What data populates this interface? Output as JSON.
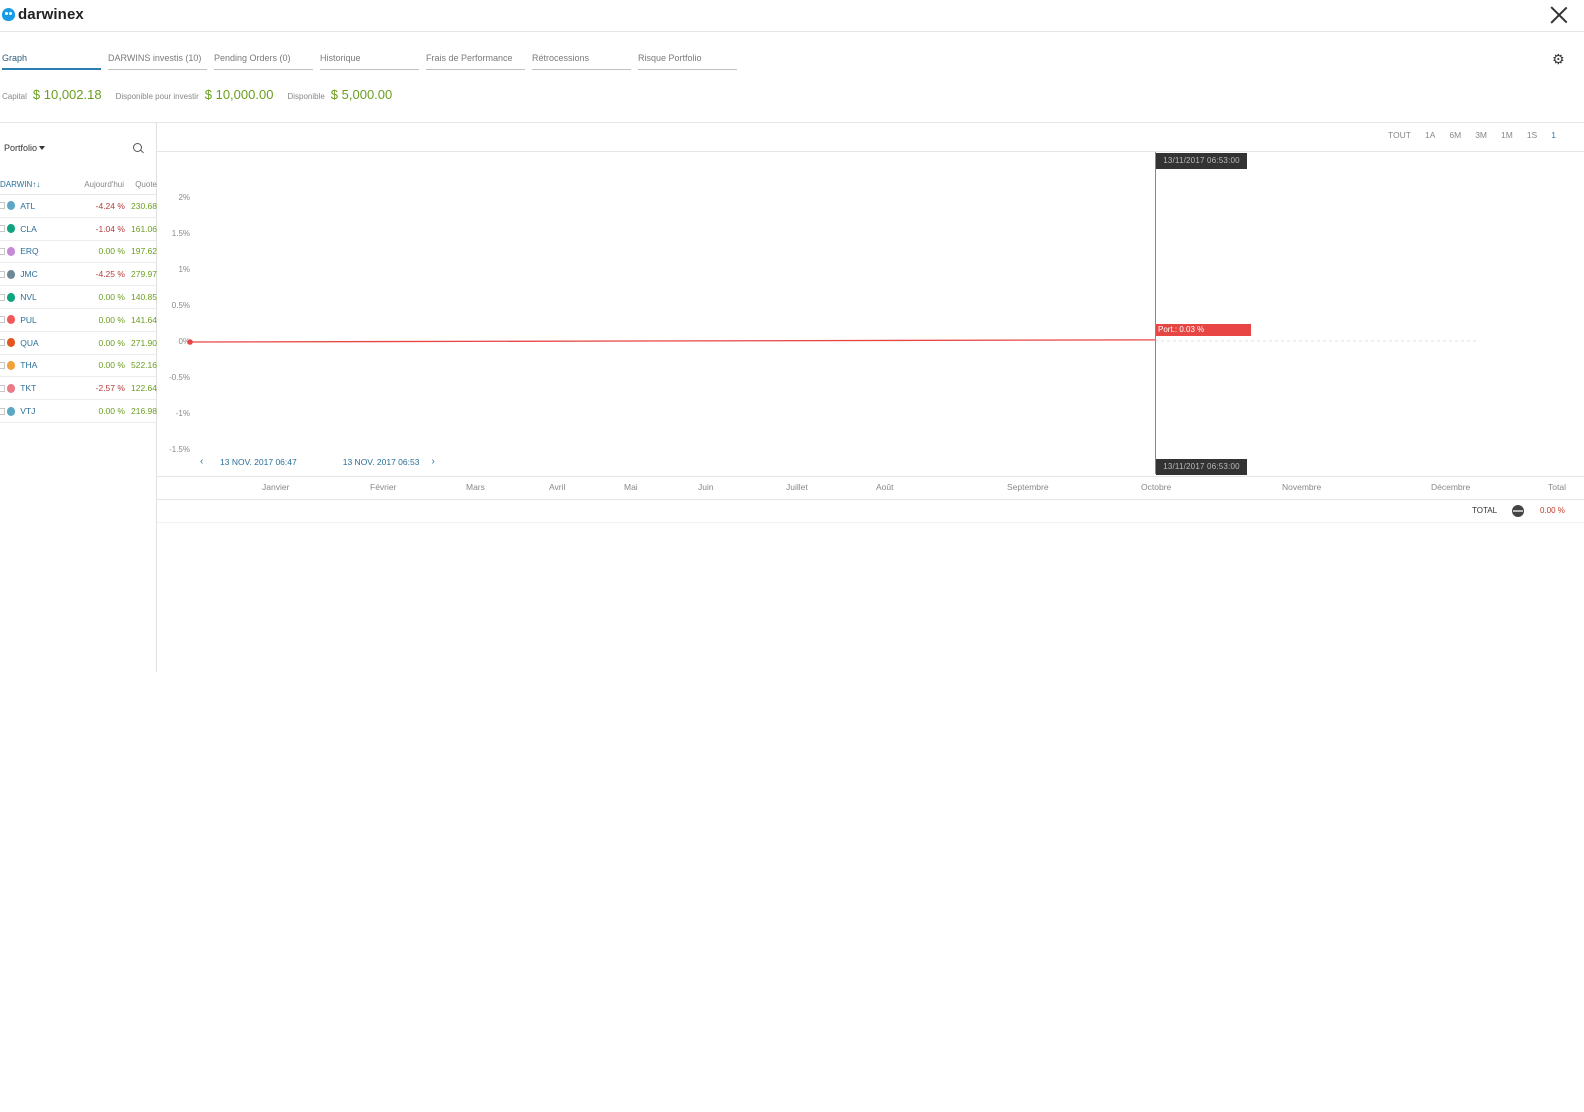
{
  "app": {
    "brand": "darwinex"
  },
  "tabs": [
    {
      "label": "Graph",
      "active": true
    },
    {
      "label": "DARWINS investis (10)"
    },
    {
      "label": "Pending Orders (0)"
    },
    {
      "label": "Historique"
    },
    {
      "label": "Frais de Performance"
    },
    {
      "label": "Rétrocessions"
    },
    {
      "label": "Risque Portfolio"
    }
  ],
  "capital": {
    "capital_label": "Capital",
    "capital_value": "$ 10,002.18",
    "invest_label": "Disponible pour investir",
    "invest_value": "$ 10,000.00",
    "avail_label": "Disponible",
    "avail_value": "$ 5,000.00"
  },
  "left": {
    "portfolio_label": "Portfolio",
    "headers": {
      "darwin": "DARWIN↑↓",
      "today": "Aujourd'hui",
      "quote": "Quote"
    },
    "rows": [
      {
        "name": "ATL",
        "today": "-4.24 %",
        "quote": "230.68",
        "color": "#5ba7c4",
        "neg": true
      },
      {
        "name": "CLA",
        "today": "-1.04 %",
        "quote": "161.06",
        "color": "#10a37f",
        "neg": true
      },
      {
        "name": "ERQ",
        "today": "0.00 %",
        "quote": "197.62",
        "color": "#c58ad6",
        "neg": false
      },
      {
        "name": "JMC",
        "today": "-4.25 %",
        "quote": "279.97",
        "color": "#6f8796",
        "neg": true
      },
      {
        "name": "NVL",
        "today": "0.00 %",
        "quote": "140.85",
        "color": "#10a37f",
        "neg": false
      },
      {
        "name": "PUL",
        "today": "0.00 %",
        "quote": "141.64",
        "color": "#ee5a5a",
        "neg": false
      },
      {
        "name": "QUA",
        "today": "0.00 %",
        "quote": "271.90",
        "color": "#e2561f",
        "neg": false
      },
      {
        "name": "THA",
        "today": "0.00 %",
        "quote": "522.16",
        "color": "#f2a23a",
        "neg": false
      },
      {
        "name": "TKT",
        "today": "-2.57 %",
        "quote": "122.64",
        "color": "#ea7a86",
        "neg": true
      },
      {
        "name": "VTJ",
        "today": "0.00 %",
        "quote": "216.98",
        "color": "#5ba7c4",
        "neg": false
      }
    ]
  },
  "ranges": [
    {
      "label": "TOUT"
    },
    {
      "label": "1A"
    },
    {
      "label": "6M"
    },
    {
      "label": "3M"
    },
    {
      "label": "1M"
    },
    {
      "label": "1S"
    },
    {
      "label": "1",
      "active": true
    }
  ],
  "chart": {
    "tooltip_top": "13/11/2017 06:53:00",
    "tooltip_bottom": "13/11/2017 06:53:00",
    "port_tag": "Port.: 0.03 %",
    "nav_start": "13 NOV. 2017 06:47",
    "nav_end": "13 NOV. 2017 06:53"
  },
  "chart_data": {
    "type": "line",
    "y_ticks": [
      "2%",
      "1.5%",
      "1%",
      "0.5%",
      "0%",
      "-0.5%",
      "-1%",
      "-1.5%"
    ],
    "ylim": [
      -1.5,
      2
    ],
    "series": [
      {
        "name": "Port.",
        "color": "#e84545",
        "points": [
          {
            "x": "13/11/2017 06:47",
            "y": 0.0
          },
          {
            "x": "13/11/2017 06:53",
            "y": 0.03
          }
        ]
      }
    ]
  },
  "months": [
    "Janvier",
    "Février",
    "Mars",
    "Avril",
    "Mai",
    "Juin",
    "Juillet",
    "Août",
    "Septembre",
    "Octobre",
    "Novembre",
    "Décembre",
    "Total"
  ],
  "total": {
    "label": "TOTAL",
    "value": "0.00 %"
  }
}
